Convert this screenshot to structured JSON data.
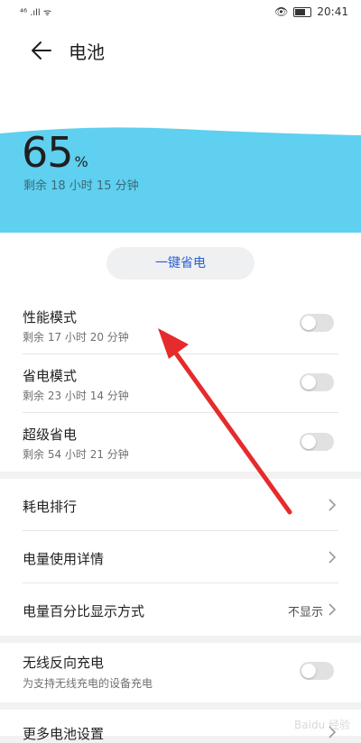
{
  "status": {
    "signal_text": "⁴⁶ .ıll ᯤ",
    "time": "20:41"
  },
  "header": {
    "title": "电池"
  },
  "battery": {
    "percent": "65",
    "percent_symbol": "%",
    "remaining": "剩余 18 小时 15 分钟",
    "wave_color": "#5fd0ef"
  },
  "one_key_saver": {
    "label": "一键省电",
    "text_color": "#2d5fd2"
  },
  "modes": [
    {
      "title": "性能模式",
      "subtitle": "剩余 17 小时 20 分钟",
      "enabled": false
    },
    {
      "title": "省电模式",
      "subtitle": "剩余 23 小时 14 分钟",
      "enabled": false
    },
    {
      "title": "超级省电",
      "subtitle": "剩余 54 小时 21 分钟",
      "enabled": false
    }
  ],
  "menu": [
    {
      "title": "耗电排行",
      "value": ""
    },
    {
      "title": "电量使用详情",
      "value": ""
    },
    {
      "title": "电量百分比显示方式",
      "value": "不显示"
    }
  ],
  "wireless": {
    "title": "无线反向充电",
    "subtitle": "为支持无线充电的设备充电",
    "enabled": false
  },
  "more": {
    "title": "更多电池设置"
  },
  "annotation": {
    "arrow_color": "#e52b2b"
  },
  "watermark": {
    "text": "Baidu 经验"
  }
}
